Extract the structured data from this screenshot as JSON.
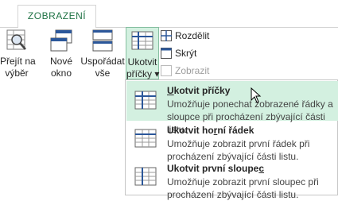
{
  "ribbon": {
    "tab_label": "ZOBRAZENÍ",
    "buttons": [
      {
        "line1": "Přejít na",
        "line2": "výběr",
        "icon": "zoom-to-selection-icon"
      },
      {
        "line1": "Nové",
        "line2": "okno",
        "icon": "new-window-icon"
      },
      {
        "line1": "Uspořádat",
        "line2": "vše",
        "icon": "arrange-all-icon"
      },
      {
        "line1": "Ukotvit",
        "line2": "příčky ▾",
        "icon": "freeze-panes-icon"
      }
    ],
    "window_group": {
      "split_label": "Rozdělit",
      "hide_label": "Skrýt",
      "unhide_label": "Zobrazit"
    }
  },
  "dropdown": {
    "items": [
      {
        "title_prefix": "",
        "title_accel": "U",
        "title_rest": "kotvit příčky",
        "description": "Umožňuje ponechat zobrazené řádky a sloupce při procházení zbývající části listu.",
        "icon": "freeze-panes-icon",
        "highlighted": true
      },
      {
        "title_prefix": "Ukotvit ho",
        "title_accel": "r",
        "title_rest": "ní řádek",
        "description": "Umožňuje zobrazit první řádek při procházení zbývající části listu.",
        "icon": "freeze-top-row-icon",
        "highlighted": false
      },
      {
        "title_prefix": "Ukotvit první sloupe",
        "title_accel": "c",
        "title_rest": "",
        "description": "Umožňuje zobrazit první sloupec při procházení zbývající části listu.",
        "icon": "freeze-first-column-icon",
        "highlighted": false
      }
    ]
  },
  "colors": {
    "accent": "#217346",
    "highlight": "#d3f0e0",
    "icon_blue": "#2b579a"
  }
}
